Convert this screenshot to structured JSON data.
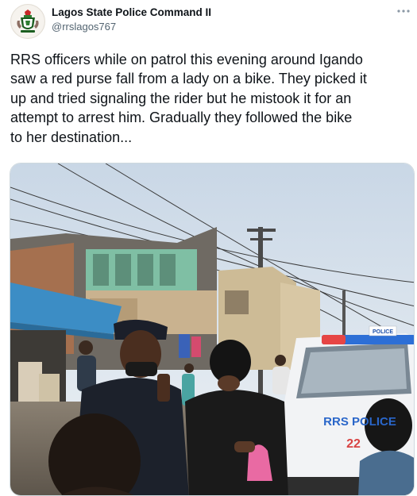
{
  "tweet": {
    "author_name": "Lagos State Police Command II",
    "author_handle": "@rrslagos767",
    "text": "RRS officers while on patrol this evening around Igando\nsaw a red purse fall from a lady on a bike. They picked it\nup and tried signaling the rider but he mistook it for an\nattempt to arrest him. Gradually they followed the bike\nto her destination..."
  },
  "icons": {
    "avatar": "police-crest-icon",
    "more": "more-options-icon"
  },
  "photo": {
    "vehicle_roof_sign": "POLICE",
    "vehicle_door_lettering": "RRS POLICE",
    "vehicle_door_number": "22"
  },
  "colors": {
    "text": "#0f1419",
    "secondary": "#536471",
    "border": "#cfd9de"
  }
}
